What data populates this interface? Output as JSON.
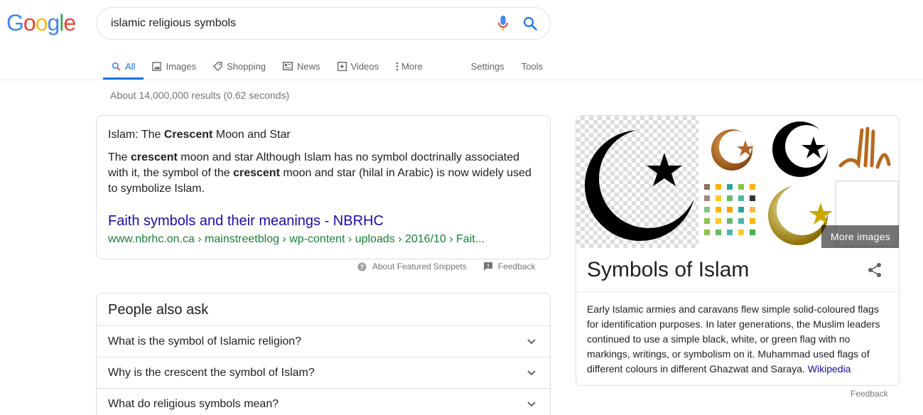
{
  "logo": {
    "letters": [
      "G",
      "o",
      "o",
      "g",
      "l",
      "e"
    ],
    "colors": [
      "#4285F4",
      "#EA4335",
      "#FBBC05",
      "#4285F4",
      "#34A853",
      "#EA4335"
    ]
  },
  "search": {
    "query": "islamic religious symbols"
  },
  "tabs": [
    {
      "label": "All",
      "icon": "search-icon"
    },
    {
      "label": "Images",
      "icon": "image-icon"
    },
    {
      "label": "Shopping",
      "icon": "tag-icon"
    },
    {
      "label": "News",
      "icon": "news-icon"
    },
    {
      "label": "Videos",
      "icon": "play-icon"
    },
    {
      "label": "More",
      "icon": "more-vert-icon"
    }
  ],
  "tools": {
    "settings": "Settings",
    "tools": "Tools"
  },
  "stats": "About 14,000,000 results (0.62 seconds)",
  "snippet": {
    "title_prefix": "Islam: The ",
    "title_bold": "Crescent",
    "title_suffix": " Moon and Star",
    "body_parts": [
      "The ",
      "crescent",
      " moon and star Although Islam has no symbol doctrinally associated with it, the symbol of the ",
      "crescent",
      " moon and star (hilal in Arabic) is now widely used to symbolize Islam."
    ],
    "link_text": "Faith symbols and their meanings - NBRHC",
    "url": "www.nbrhc.on.ca › mainstreetblog › wp-content › uploads › 2016/10 › Fait..."
  },
  "snippet_footer": {
    "about": "About Featured Snippets",
    "feedback": "Feedback"
  },
  "paa": {
    "heading": "People also ask",
    "questions": [
      "What is the symbol of Islamic religion?",
      "Why is the crescent the symbol of Islam?",
      "What do religious symbols mean?"
    ]
  },
  "knowledge_panel": {
    "more_images": "More images",
    "title": "Symbols of Islam",
    "description": "Early Islamic armies and caravans flew simple solid-coloured flags for identification purposes. In later generations, the Muslim leaders continued to use a simple black, white, or green flag with no markings, writings, or symbolism on it. Muhammad used flags of different colours in different Ghazwat and Saraya.",
    "source": "Wikipedia",
    "feedback": "Feedback"
  }
}
